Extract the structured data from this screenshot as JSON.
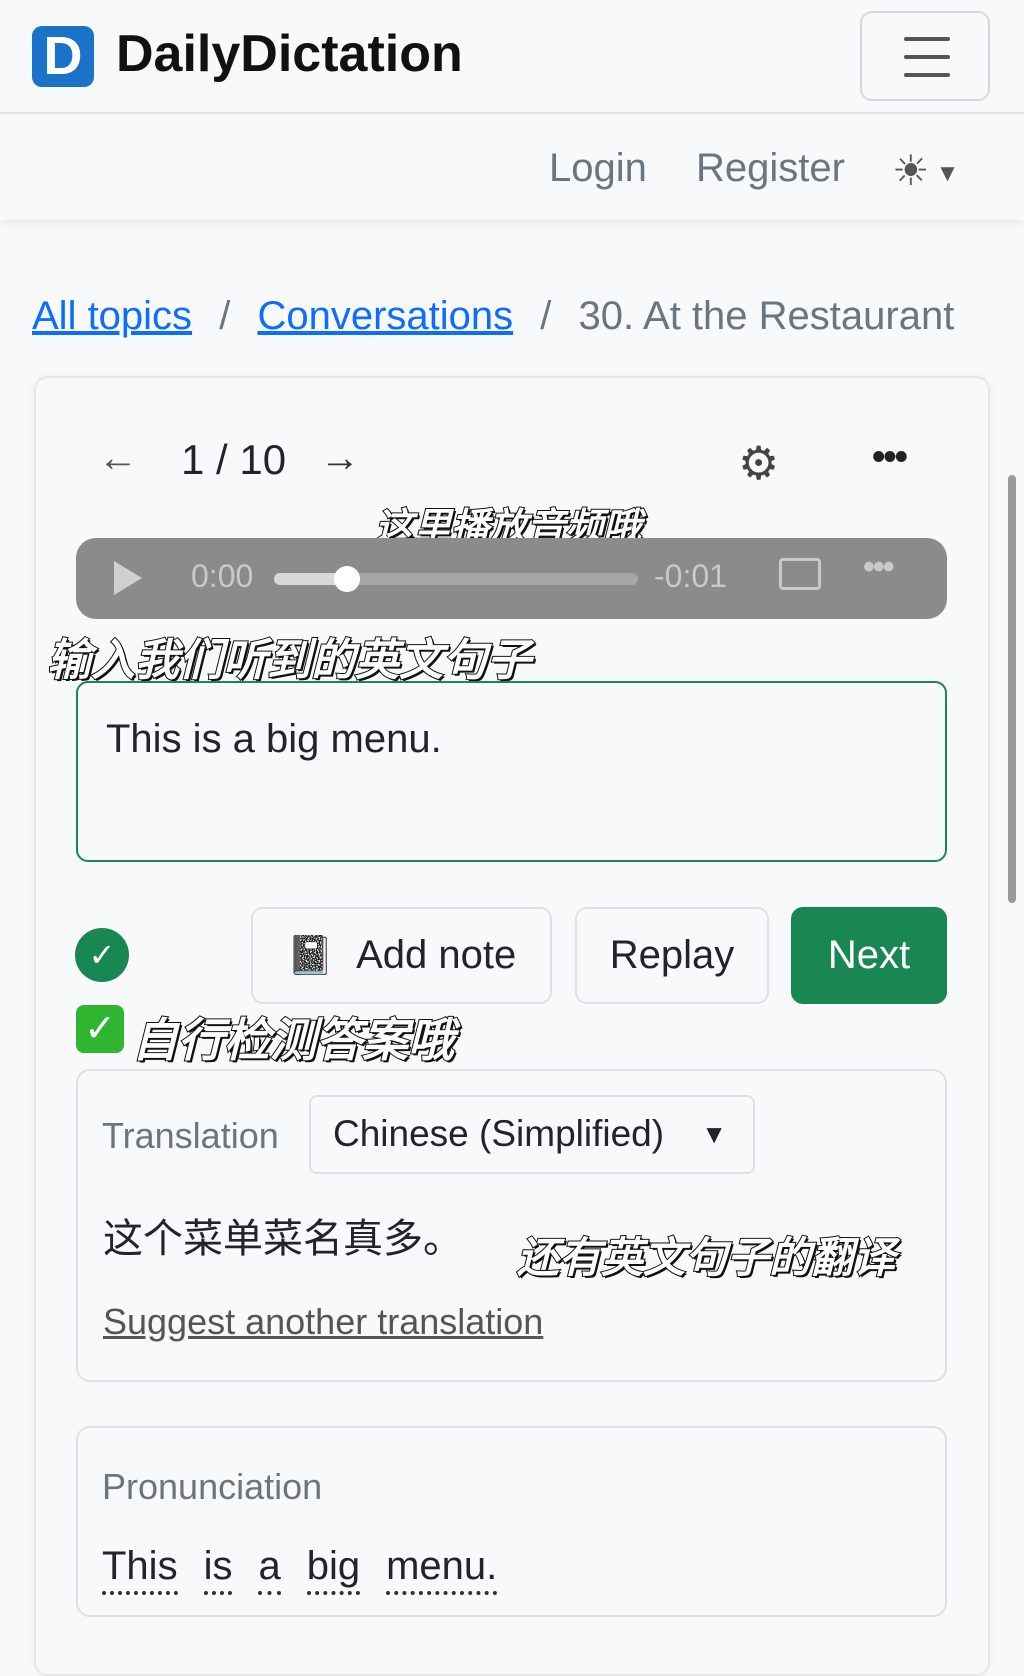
{
  "header": {
    "logo_letter": "D",
    "brand": "DailyDictation"
  },
  "nav": {
    "login": "Login",
    "register": "Register"
  },
  "breadcrumb": {
    "items": [
      "All topics",
      "Conversations"
    ],
    "separator": "/",
    "current": "30. At the Restaurant"
  },
  "toolbar": {
    "counter": "1 / 10"
  },
  "player": {
    "current_time": "0:00",
    "remaining_time": "-0:01",
    "progress": 0.2
  },
  "annotations": {
    "audio": "这里播放音频哦",
    "input": "输入我们听到的英文句子",
    "check": "自行检测答案哦",
    "translation": "还有英文句子的翻译"
  },
  "answer": {
    "value": "This is a big menu."
  },
  "actions": {
    "add_note": "Add note",
    "replay": "Replay",
    "next": "Next"
  },
  "translation": {
    "label": "Translation",
    "language": "Chinese (Simplified)",
    "text": "这个菜单菜名真多。",
    "suggest_link": "Suggest another translation"
  },
  "pronunciation": {
    "label": "Pronunciation",
    "words": [
      "This",
      "is",
      "a",
      "big",
      "menu."
    ]
  },
  "colors": {
    "primary": "#198754",
    "link": "#0d6efd",
    "logo": "#1a73c9"
  }
}
